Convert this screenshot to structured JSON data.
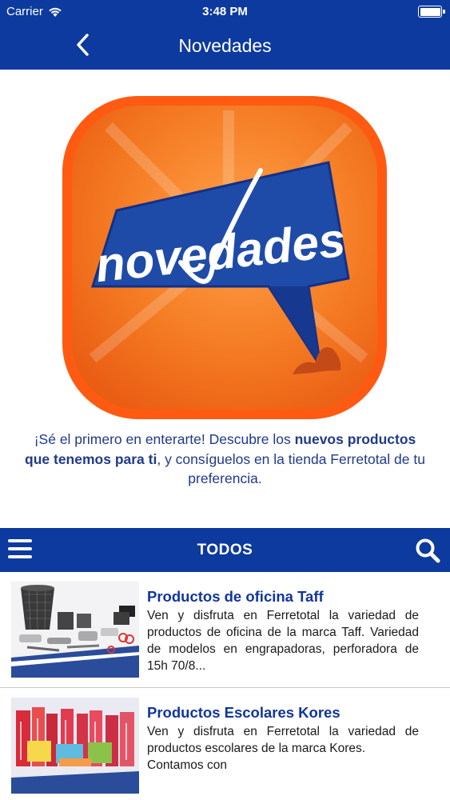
{
  "status_bar": {
    "carrier": "Carrier",
    "time": "3:48 PM"
  },
  "nav": {
    "title": "Novedades",
    "back_icon": "chevron-left-icon"
  },
  "hero": {
    "logo_text": "novedades",
    "colors": {
      "orange": "#f26a1b",
      "blue": "#1f4ba8"
    }
  },
  "intro": {
    "part1": "¡Sé el primero en enterarte! Descubre los ",
    "bold": "nuevos productos que tenemos para ti",
    "part2": ", y consíguelos en la tienda Ferretotal de tu preferencia."
  },
  "category_bar": {
    "title": "TODOS",
    "menu_icon": "hamburger-menu-icon",
    "search_icon": "search-icon"
  },
  "products": [
    {
      "title": "Productos de oficina Taff",
      "description": "Ven y disfruta en Ferretotal la variedad de productos de oficina de la marca Taff. Variedad de modelos en engrapadoras, perforadora de 15h 70/8..."
    },
    {
      "title": "Productos Escolares Kores",
      "description": "Ven y disfruta en Ferretotal la variedad de productos escolares de la marca Kores.",
      "description_more": "Contamos con"
    }
  ],
  "theme": {
    "primary": "#0d3a9e",
    "text_blue": "#12359a"
  }
}
